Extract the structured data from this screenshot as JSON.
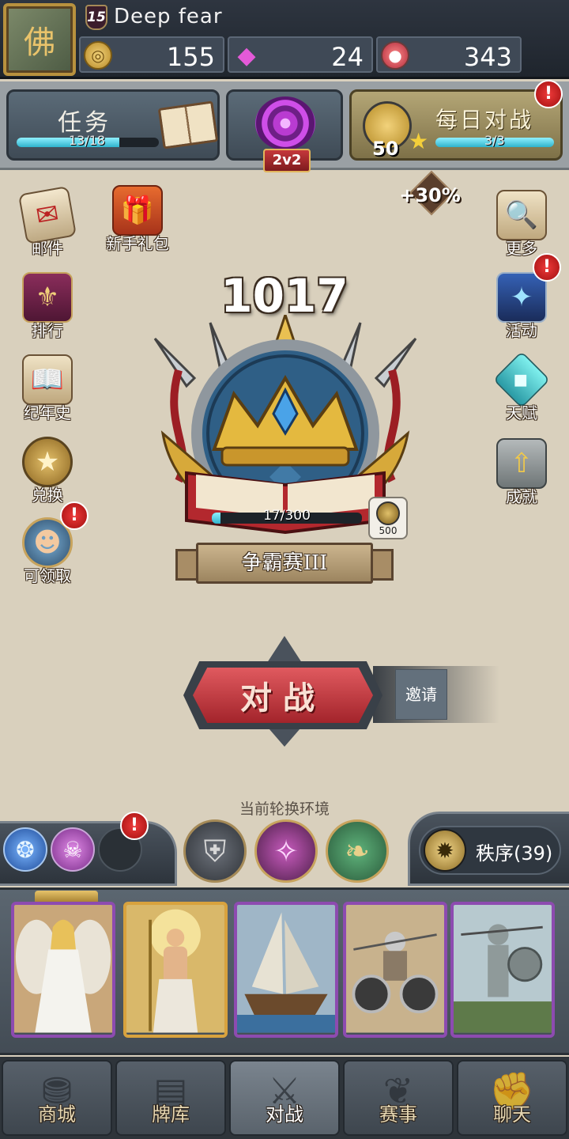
{
  "player": {
    "level": "15",
    "name": "Deep  fear",
    "avatar_glyph": "佛"
  },
  "currency": {
    "gold": {
      "value": "155",
      "icon": "gold-coin-icon"
    },
    "gems": {
      "value": "24",
      "icon": "purple-gem-icon"
    },
    "potion": {
      "value": "343",
      "icon": "potion-icon"
    }
  },
  "quest": {
    "label": "任务",
    "progress_text": "13/18",
    "progress": 0.72
  },
  "mode": {
    "tag": "2v2"
  },
  "daily": {
    "label": "每日对战",
    "coin_value": "50",
    "progress_text": "3/3",
    "progress": 1.0
  },
  "bonus": "+30%",
  "left_menu": [
    {
      "label": "邮件",
      "icon": "mail-icon",
      "glyph": "✉"
    },
    {
      "label": "新手礼包",
      "icon": "gift-icon",
      "glyph": "🎁"
    },
    {
      "label": "排行",
      "icon": "rank-banner-icon",
      "glyph": "⚜"
    },
    {
      "label": "纪年史",
      "icon": "open-book-icon",
      "glyph": "📖"
    },
    {
      "label": "兑换",
      "icon": "exchange-medal-icon",
      "glyph": "★"
    },
    {
      "label": "可领取",
      "icon": "hero-portrait-icon",
      "glyph": "☻"
    }
  ],
  "right_menu": [
    {
      "label": "更多",
      "icon": "magnifier-scroll-icon",
      "glyph": "🔍"
    },
    {
      "label": "活动",
      "icon": "portal-icon",
      "glyph": "✦"
    },
    {
      "label": "天赋",
      "icon": "crystal-icon",
      "glyph": "◆"
    },
    {
      "label": "成就",
      "icon": "laurel-arrow-icon",
      "glyph": "⇧"
    }
  ],
  "rank": {
    "rating": "1017",
    "progress_text": "17/300",
    "progress": 0.057,
    "reward_value": "500",
    "title": "争霸赛III"
  },
  "battle": {
    "label": "对战",
    "invite_label": "邀请"
  },
  "environment": {
    "title": "当前轮换环境",
    "order_label": "秩序(39)"
  },
  "alerts": {
    "mark": "!"
  },
  "nav": [
    {
      "label": "商城",
      "icon": "shop-icon",
      "glyph": "⛃"
    },
    {
      "label": "牌库",
      "icon": "card-deck-icon",
      "glyph": "▤"
    },
    {
      "label": "对战",
      "icon": "crossed-swords-icon",
      "glyph": "⚔"
    },
    {
      "label": "赛事",
      "icon": "tournament-laurel-icon",
      "glyph": "❦"
    },
    {
      "label": "聊天",
      "icon": "chat-fist-icon",
      "glyph": "✊"
    }
  ],
  "colors": {
    "accent_red": "#c5383b",
    "progress_cyan": "#2fb3cc",
    "gold_frame": "#b8913e",
    "epic_border": "#8d4bb0",
    "legendary_border": "#d8a23e"
  }
}
